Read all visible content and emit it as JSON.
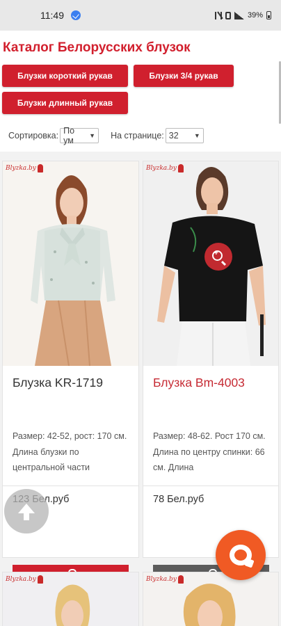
{
  "status_bar": {
    "time": "11:49",
    "battery": "39%"
  },
  "catalog": {
    "title": "Каталог Белорусских блузок",
    "categories": [
      {
        "label": "Блузки короткий рукав"
      },
      {
        "label": "Блузки 3/4 рукав"
      },
      {
        "label": "Блузки длинный рукав"
      }
    ]
  },
  "controls": {
    "sort_label": "Сортировка:",
    "sort_value": "По ум",
    "per_page_label": "На странице:",
    "per_page_value": "32"
  },
  "products": [
    {
      "name": "Блузка KR-1719",
      "description": "Размер: 42-52, рост: 170 см. Длина блузки по центральной части",
      "price": "123 Бел.руб",
      "brand": "Blyzka.by",
      "button_color": "#d0202e"
    },
    {
      "name": "Блузка Bm-4003",
      "description": "Размер: 48-62. Рост 170 см. Длина по центру спинки: 66 см. Длина",
      "price": "78 Бел.руб",
      "brand": "Blyzka.by",
      "button_color": "#5c5c5c"
    },
    {
      "brand": "Blyzka.by"
    },
    {
      "brand": "Blyzka.by"
    }
  ],
  "colors": {
    "accent": "#d0202e",
    "chat": "#f05a24"
  }
}
